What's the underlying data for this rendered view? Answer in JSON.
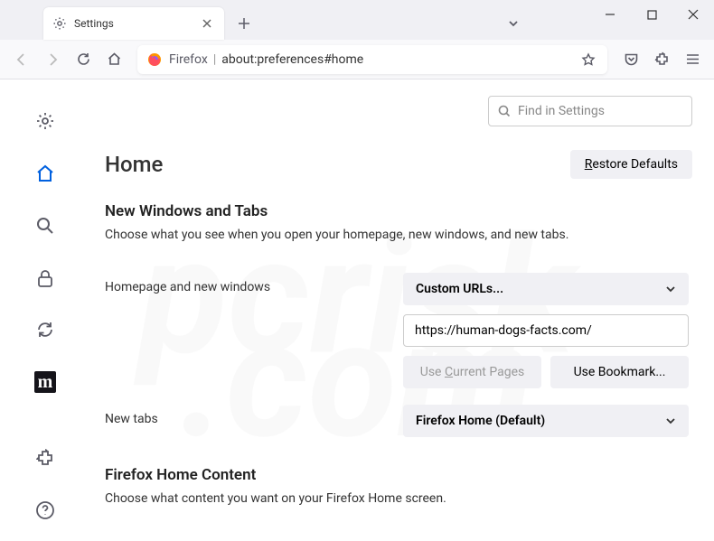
{
  "tab": {
    "title": "Settings"
  },
  "urlbar": {
    "prefix": "Firefox",
    "url": "about:preferences#home"
  },
  "search": {
    "placeholder": "Find in Settings"
  },
  "page": {
    "title": "Home",
    "restore": "estore Defaults",
    "section1_title": "New Windows and Tabs",
    "section1_desc": "Choose what you see when you open your homepage, new windows, and new tabs.",
    "homepage_label": "Homepage and new windows",
    "homepage_select": "Custom URLs...",
    "homepage_url": "https://human-dogs-facts.com/",
    "use_current": "urrent Pages",
    "use_bookmark": "Use Bookmark...",
    "newtabs_label": "New tabs",
    "newtabs_select": "Firefox Home (Default)",
    "section2_title": "Firefox Home Content",
    "section2_desc": "Choose what content you want on your Firefox Home screen."
  }
}
